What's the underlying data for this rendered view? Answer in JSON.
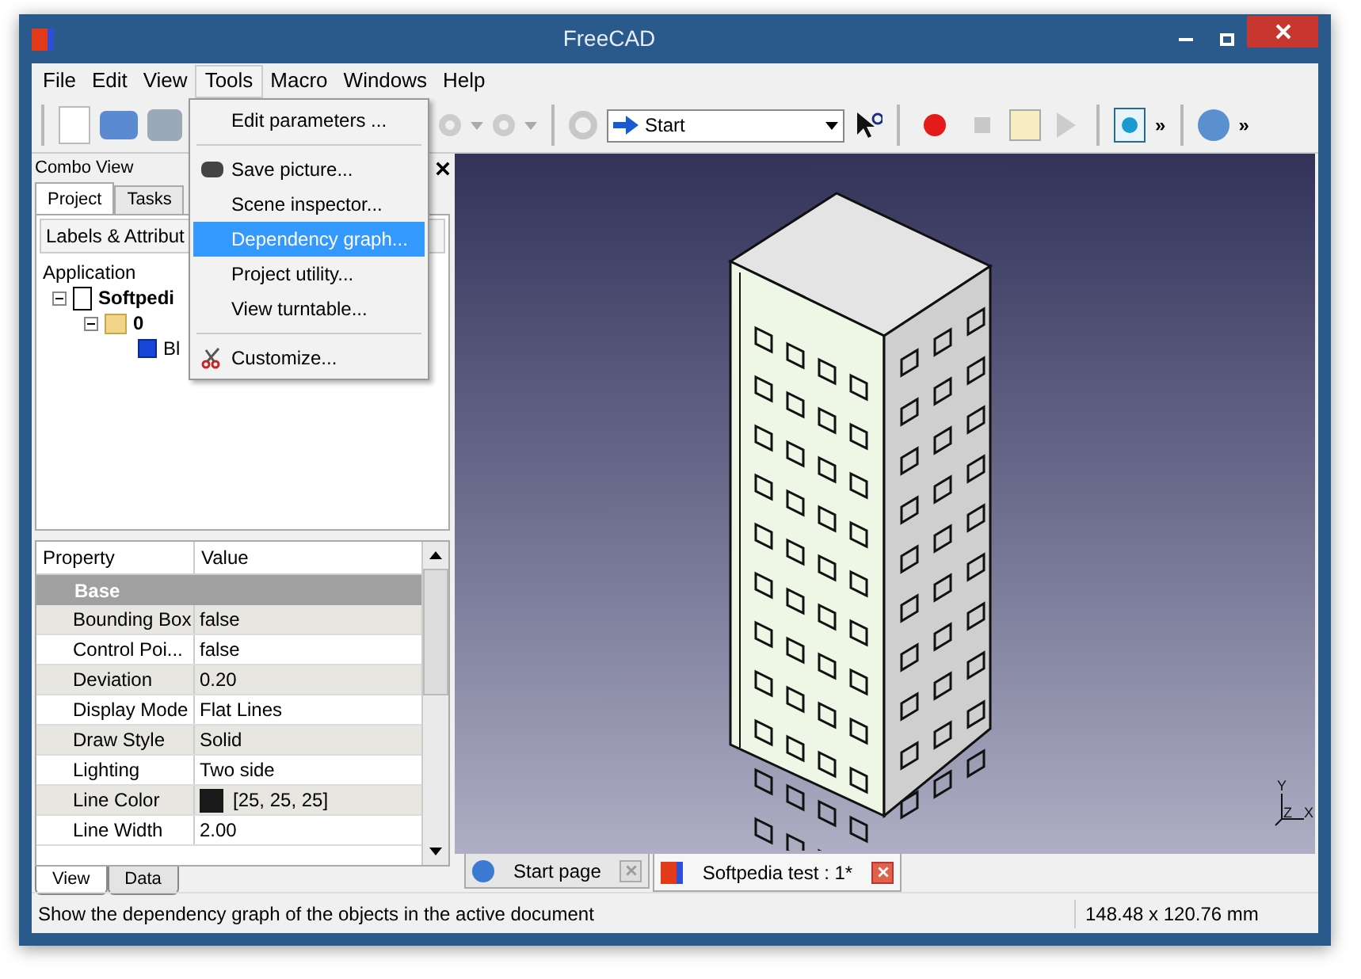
{
  "window": {
    "title": "FreeCAD"
  },
  "menu_bar": [
    {
      "label": "File",
      "selected": false
    },
    {
      "label": "Edit",
      "selected": false
    },
    {
      "label": "View",
      "selected": false
    },
    {
      "label": "Tools",
      "selected": true
    },
    {
      "label": "Macro",
      "selected": false
    },
    {
      "label": "Windows",
      "selected": false
    },
    {
      "label": "Help",
      "selected": false
    }
  ],
  "tools_menu": [
    {
      "kind": "item",
      "label": "Edit parameters ...",
      "selected": false
    },
    {
      "kind": "separator"
    },
    {
      "kind": "item",
      "label": "Save picture...",
      "selected": false
    },
    {
      "kind": "item",
      "label": "Scene inspector...",
      "selected": false
    },
    {
      "kind": "item",
      "label": "Dependency graph...",
      "selected": true
    },
    {
      "kind": "item",
      "label": "Project utility...",
      "selected": false
    },
    {
      "kind": "item",
      "label": "View turntable...",
      "selected": false
    },
    {
      "kind": "separator"
    },
    {
      "kind": "item",
      "label": "Customize...",
      "selected": false
    }
  ],
  "toolbar": {
    "workbench": "Start",
    "overflow": [
      "»",
      "»"
    ]
  },
  "combo_view": {
    "title": "Combo View",
    "tabs": [
      {
        "label": "Project",
        "selected": true
      },
      {
        "label": "Tasks",
        "selected": false
      }
    ],
    "tree": {
      "header": "Labels & Attribut",
      "items": [
        {
          "label": "Application",
          "children": [
            {
              "label": "Softpedi",
              "children": [
                {
                  "label": "0",
                  "children": [
                    {
                      "label": "Bl"
                    }
                  ]
                }
              ]
            }
          ]
        }
      ]
    }
  },
  "properties": {
    "columns": [
      "Property",
      "Value"
    ],
    "group": "Base",
    "rows": [
      {
        "property": "Bounding Box",
        "value": "false"
      },
      {
        "property": "Control Poi...",
        "value": "false"
      },
      {
        "property": "Deviation",
        "value": "0.20"
      },
      {
        "property": "Display Mode",
        "value": "Flat Lines"
      },
      {
        "property": "Draw Style",
        "value": "Solid"
      },
      {
        "property": "Lighting",
        "value": "Two side"
      },
      {
        "property": "Line Color",
        "value": "[25, 25, 25]",
        "color": "#191919"
      },
      {
        "property": "Line Width",
        "value": "2.00"
      }
    ],
    "tabs": [
      {
        "label": "View",
        "selected": true
      },
      {
        "label": "Data",
        "selected": false
      }
    ]
  },
  "viewport": {
    "axis": {
      "x": "X",
      "y": "Y",
      "z": "Z"
    }
  },
  "document_tabs": [
    {
      "label": "Start page",
      "selected": false
    },
    {
      "label": "Softpedia test : 1*",
      "selected": true
    }
  ],
  "status_bar": {
    "message": "Show the dependency graph of the objects in the active document",
    "dimensions": "148.48 x 120.76 mm"
  }
}
